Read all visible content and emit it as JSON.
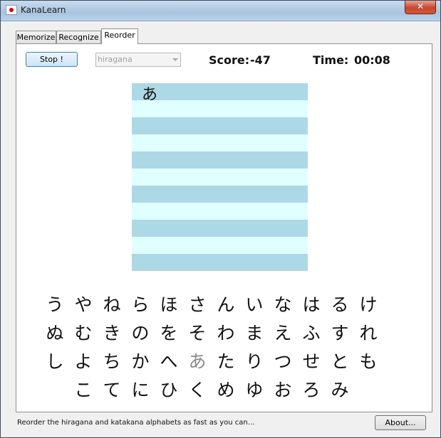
{
  "window": {
    "title": "KanaLearn",
    "close_glyph": "✕"
  },
  "tabs": [
    {
      "label": "Memorize"
    },
    {
      "label": "Recognize"
    },
    {
      "label": "Reorder",
      "active": true
    }
  ],
  "toolbar": {
    "stop_label": "Stop !",
    "alphabet_selected": "hiragana",
    "score_label": "Score:",
    "score_value": "-47",
    "time_label": "Time:",
    "time_value": "00:08"
  },
  "board": {
    "placed": [
      "あ"
    ]
  },
  "kana_rows": [
    [
      "う",
      "や",
      "ね",
      "ら",
      "ほ",
      "さ",
      "ん",
      "い",
      "な",
      "は",
      "る",
      "け"
    ],
    [
      "ぬ",
      "む",
      "き",
      "の",
      "を",
      "そ",
      "わ",
      "ま",
      "え",
      "ふ",
      "す",
      "れ"
    ],
    [
      "し",
      "よ",
      "ち",
      "か",
      "へ",
      "あ",
      "た",
      "り",
      "つ",
      "せ",
      "と",
      "も"
    ],
    [
      "こ",
      "て",
      "に",
      "ひ",
      "く",
      "め",
      "ゆ",
      "お",
      "ろ",
      "み"
    ]
  ],
  "faded_kana": "あ",
  "status": {
    "text": "Reorder the hiragana and katakana alphabets as fast as you can...",
    "about_label": "About..."
  },
  "colors": {
    "stripe_dark": "#add8e6",
    "stripe_light": "#e0ffff",
    "flag_red": "#d8001b"
  }
}
